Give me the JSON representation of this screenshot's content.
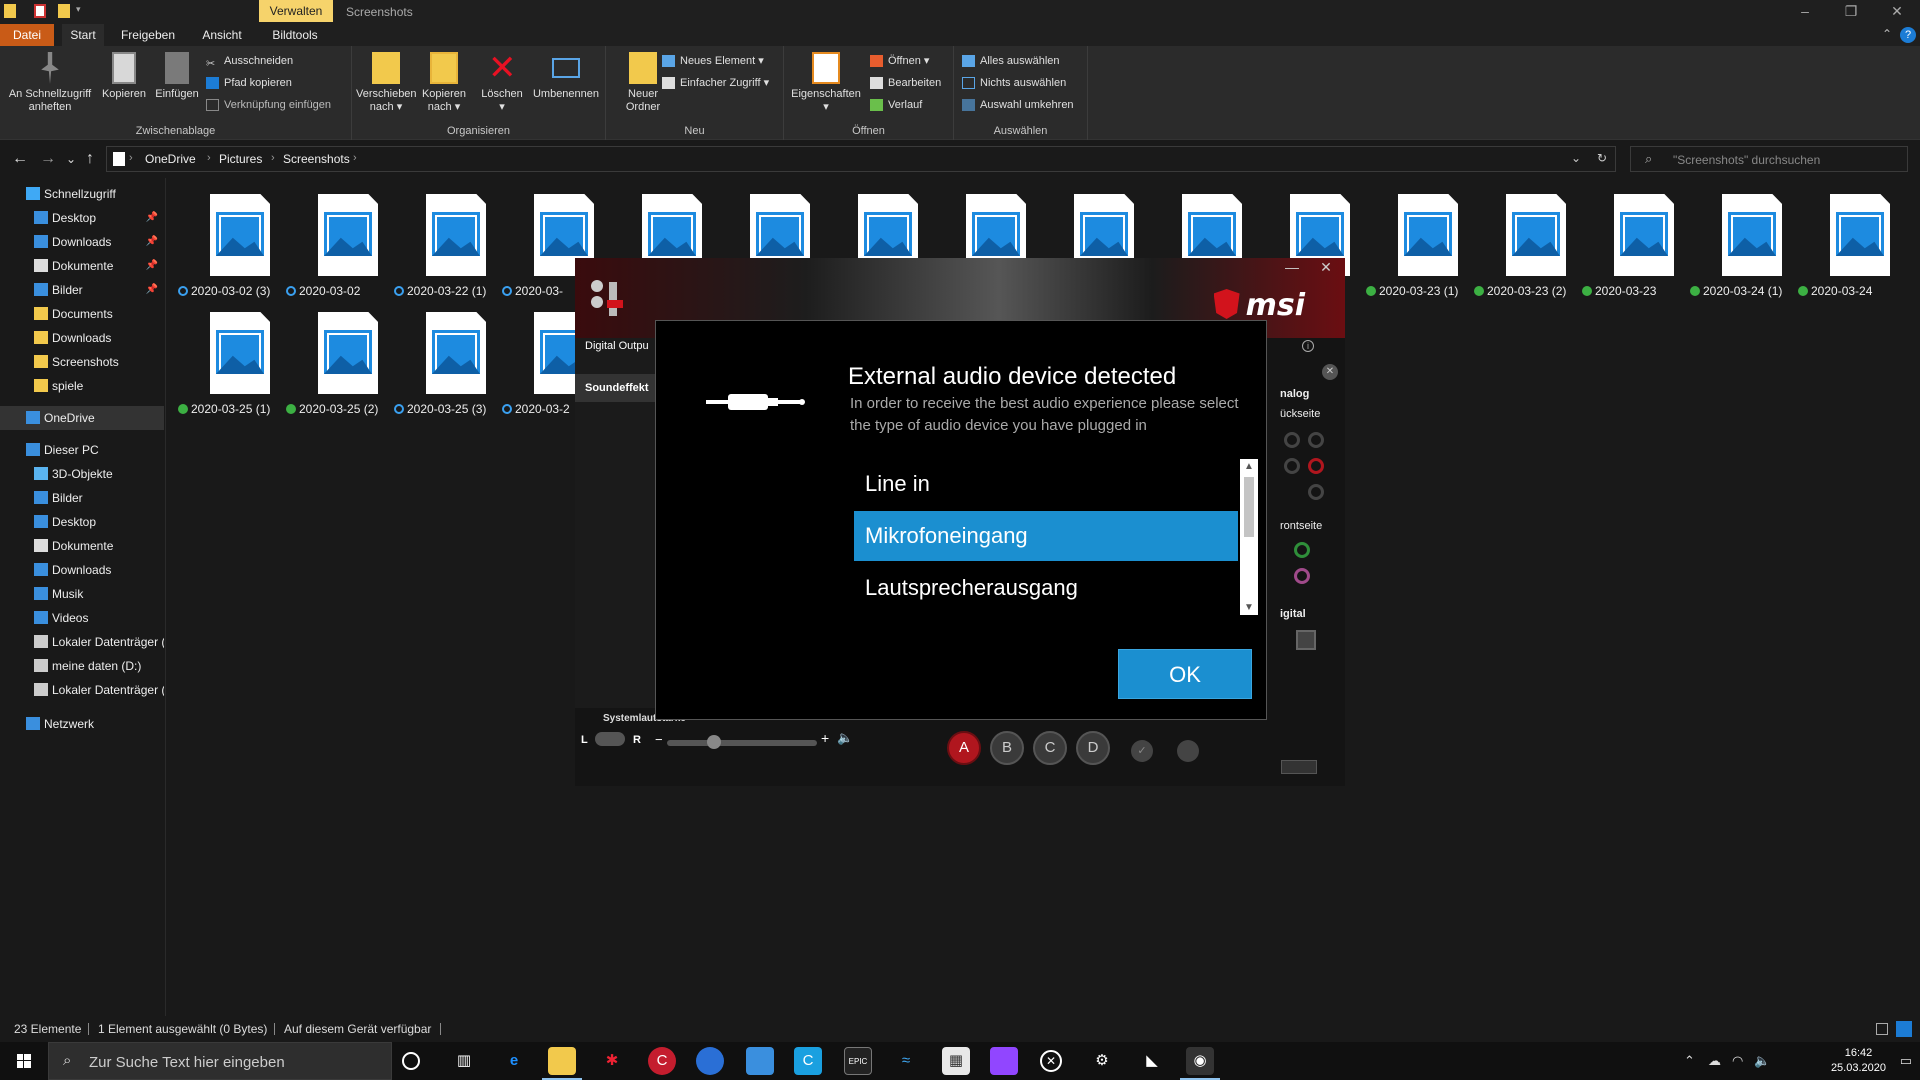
{
  "titlebar": {
    "context_tab": "Verwalten",
    "title": "Screenshots",
    "minimize": "–",
    "maximize": "❐",
    "close": "✕"
  },
  "ribbon_tabs": {
    "datei": "Datei",
    "start": "Start",
    "freigeben": "Freigeben",
    "ansicht": "Ansicht",
    "bildtools": "Bildtools",
    "collapse": "⌃",
    "help": "?"
  },
  "ribbon": {
    "clipboard": {
      "label": "Zwischenablage",
      "pin": "An Schnellzugriff anheften",
      "copy": "Kopieren",
      "paste": "Einfügen",
      "cut": "Ausschneiden",
      "copy_path": "Pfad kopieren",
      "paste_shortcut": "Verknüpfung einfügen"
    },
    "organize": {
      "label": "Organisieren",
      "move_to": "Verschieben nach",
      "copy_to": "Kopieren nach",
      "delete": "Löschen",
      "rename": "Umbenennen"
    },
    "new": {
      "label": "Neu",
      "new_folder": "Neuer Ordner",
      "new_item": "Neues Element",
      "easy_access": "Einfacher Zugriff"
    },
    "open": {
      "label": "Öffnen",
      "properties": "Eigenschaften",
      "open": "Öffnen",
      "edit": "Bearbeiten",
      "history": "Verlauf"
    },
    "select": {
      "label": "Auswählen",
      "select_all": "Alles auswählen",
      "select_none": "Nichts auswählen",
      "invert": "Auswahl umkehren"
    }
  },
  "address": {
    "back": "←",
    "forward": "→",
    "recent": "⌄",
    "up": "↑",
    "crumbs": [
      "OneDrive",
      "Pictures",
      "Screenshots"
    ],
    "sep": "›",
    "dropdown": "⌄",
    "refresh": "↻",
    "search_placeholder": "\"Screenshots\" durchsuchen",
    "search_icon": "⌕"
  },
  "sidebar": {
    "items": [
      {
        "label": "Schnellzugriff",
        "icon": "star-icon",
        "pinned": false
      },
      {
        "label": "Desktop",
        "icon": "desktop-folder-icon",
        "pinned": true
      },
      {
        "label": "Downloads",
        "icon": "download-icon",
        "pinned": true
      },
      {
        "label": "Dokumente",
        "icon": "documents-icon",
        "pinned": true
      },
      {
        "label": "Bilder",
        "icon": "pictures-icon",
        "pinned": true
      },
      {
        "label": "Documents",
        "icon": "folder-icon",
        "pinned": false
      },
      {
        "label": "Downloads",
        "icon": "folder-icon",
        "pinned": false
      },
      {
        "label": "Screenshots",
        "icon": "folder-icon",
        "pinned": false
      },
      {
        "label": "spiele",
        "icon": "folder-icon",
        "pinned": false
      },
      {
        "label": "OneDrive",
        "icon": "onedrive-icon",
        "pinned": false
      },
      {
        "label": "Dieser PC",
        "icon": "pc-icon",
        "pinned": false
      },
      {
        "label": "3D-Objekte",
        "icon": "3d-objects-icon",
        "pinned": false
      },
      {
        "label": "Bilder",
        "icon": "pictures-icon",
        "pinned": false
      },
      {
        "label": "Desktop",
        "icon": "desktop-folder-icon",
        "pinned": false
      },
      {
        "label": "Dokumente",
        "icon": "documents-icon",
        "pinned": false
      },
      {
        "label": "Downloads",
        "icon": "download-icon",
        "pinned": false
      },
      {
        "label": "Musik",
        "icon": "music-icon",
        "pinned": false
      },
      {
        "label": "Videos",
        "icon": "videos-icon",
        "pinned": false
      },
      {
        "label": "Lokaler Datenträger (",
        "icon": "drive-icon",
        "pinned": false
      },
      {
        "label": "meine daten  (D:)",
        "icon": "drive-icon",
        "pinned": false
      },
      {
        "label": "Lokaler Datenträger (",
        "icon": "drive-icon",
        "pinned": false
      },
      {
        "label": "Netzwerk",
        "icon": "network-icon",
        "pinned": false
      }
    ],
    "pin_glyph": "📌"
  },
  "files": [
    {
      "name": "2020-03-02 (3)",
      "status": "sync"
    },
    {
      "name": "2020-03-02",
      "status": "sync"
    },
    {
      "name": "2020-03-22 (1)",
      "status": "sync"
    },
    {
      "name": "2020-03-",
      "status": "sync"
    },
    {
      "name": "",
      "status": "none"
    },
    {
      "name": "",
      "status": "none"
    },
    {
      "name": "",
      "status": "none"
    },
    {
      "name": "",
      "status": "none"
    },
    {
      "name": "",
      "status": "none"
    },
    {
      "name": "",
      "status": "none"
    },
    {
      "name": "",
      "status": "none"
    },
    {
      "name": "2020-03-23 (1)",
      "status": "ok"
    },
    {
      "name": "2020-03-23 (2)",
      "status": "ok"
    },
    {
      "name": "2020-03-23",
      "status": "ok"
    },
    {
      "name": "2020-03-24 (1)",
      "status": "ok"
    },
    {
      "name": "2020-03-24",
      "status": "ok"
    },
    {
      "name": "2020-03-25 (1)",
      "status": "ok"
    },
    {
      "name": "2020-03-25 (2)",
      "status": "ok"
    },
    {
      "name": "2020-03-25 (3)",
      "status": "sync"
    },
    {
      "name": "2020-03-2",
      "status": "sync"
    }
  ],
  "msi": {
    "logo": "msi",
    "minimize": "—",
    "close": "✕",
    "side_digital_output": "Digital Outpu",
    "side_soundeffect": "Soundeffekt",
    "right_analog": "nalog",
    "right_back": "ückseite",
    "right_front": "rontseite",
    "right_digital": "igital",
    "volume_label": "Systemlautstärke",
    "vol_l": "L",
    "vol_r": "R",
    "vol_minus": "−",
    "vol_plus": "+",
    "speaker": "🔈",
    "buttons": [
      "A",
      "B",
      "C",
      "D"
    ]
  },
  "dialog": {
    "title": "External audio device detected",
    "description": "In order to receive the best audio experience please select the type of audio device you have plugged in",
    "options": [
      "Line in",
      "Mikrofoneingang",
      "Lautsprecherausgang"
    ],
    "selected_index": 1,
    "ok": "OK",
    "scroll_up": "▲",
    "scroll_down": "▼"
  },
  "statusbar": {
    "count": "23 Elemente",
    "selection": "1 Element ausgewählt (0 Bytes)",
    "availability": "Auf diesem Gerät verfügbar"
  },
  "taskbar": {
    "search_placeholder": "Zur Suche Text hier eingeben",
    "search_icon": "⌕",
    "time": "16:42",
    "date": "25.03.2020"
  },
  "colors": {
    "accent": "#1b8fd0",
    "datei_tab": "#c95b17",
    "msi_red": "#d2131c",
    "sync_ok": "#3cb043",
    "sync_pending": "#3aa0f0"
  }
}
